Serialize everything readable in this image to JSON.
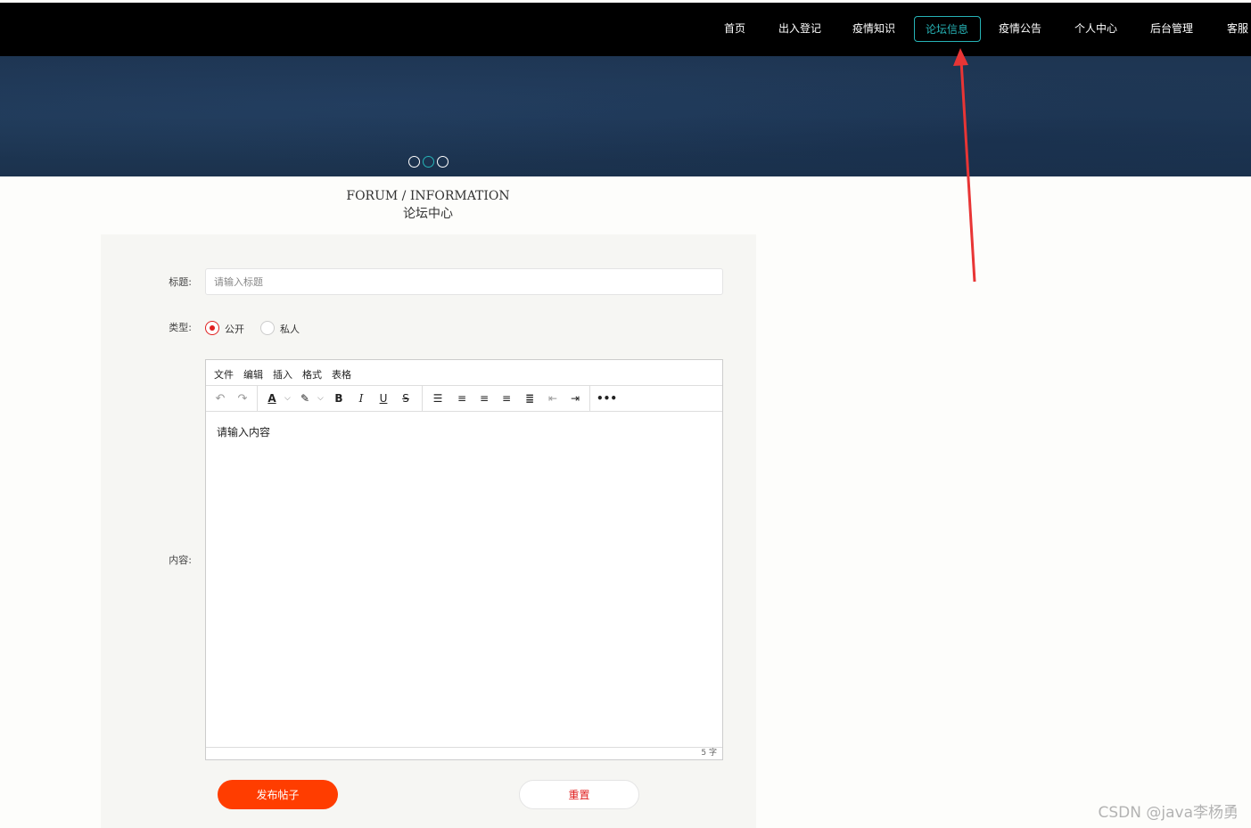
{
  "nav": {
    "items": [
      {
        "label": "首页"
      },
      {
        "label": "出入登记"
      },
      {
        "label": "疫情知识"
      },
      {
        "label": "论坛信息",
        "active": true
      },
      {
        "label": "疫情公告"
      },
      {
        "label": "个人中心"
      },
      {
        "label": "后台管理"
      },
      {
        "label": "客服"
      }
    ]
  },
  "banner": {
    "dots": 3,
    "active_dot": 2
  },
  "heading": {
    "en": "FORUM / INFORMATION",
    "cn": "论坛中心"
  },
  "form": {
    "title_label": "标题:",
    "title_placeholder": "请输入标题",
    "type_label": "类型:",
    "type_options": [
      {
        "label": "公开",
        "checked": true
      },
      {
        "label": "私人",
        "checked": false
      }
    ],
    "content_label": "内容:",
    "submit_label": "发布帖子",
    "reset_label": "重置"
  },
  "editor": {
    "menus": [
      "文件",
      "编辑",
      "插入",
      "格式",
      "表格"
    ],
    "toolbar_icons": [
      "undo-icon",
      "redo-icon",
      "text-color-icon",
      "highlight-icon",
      "bold-icon",
      "italic-icon",
      "underline-icon",
      "strikethrough-icon",
      "bullet-list-icon",
      "align-left-icon",
      "align-center-icon",
      "align-right-icon",
      "align-justify-icon",
      "outdent-icon",
      "indent-icon",
      "more-icon"
    ],
    "content": "请输入内容",
    "word_count": "5 字"
  },
  "colors": {
    "nav_bg": "#000000",
    "accent": "#26b3b6",
    "primary_button": "#ff3d00",
    "radio_checked": "#e02020",
    "annotation_arrow": "#e83535"
  },
  "watermark": "CSDN @java李杨勇"
}
